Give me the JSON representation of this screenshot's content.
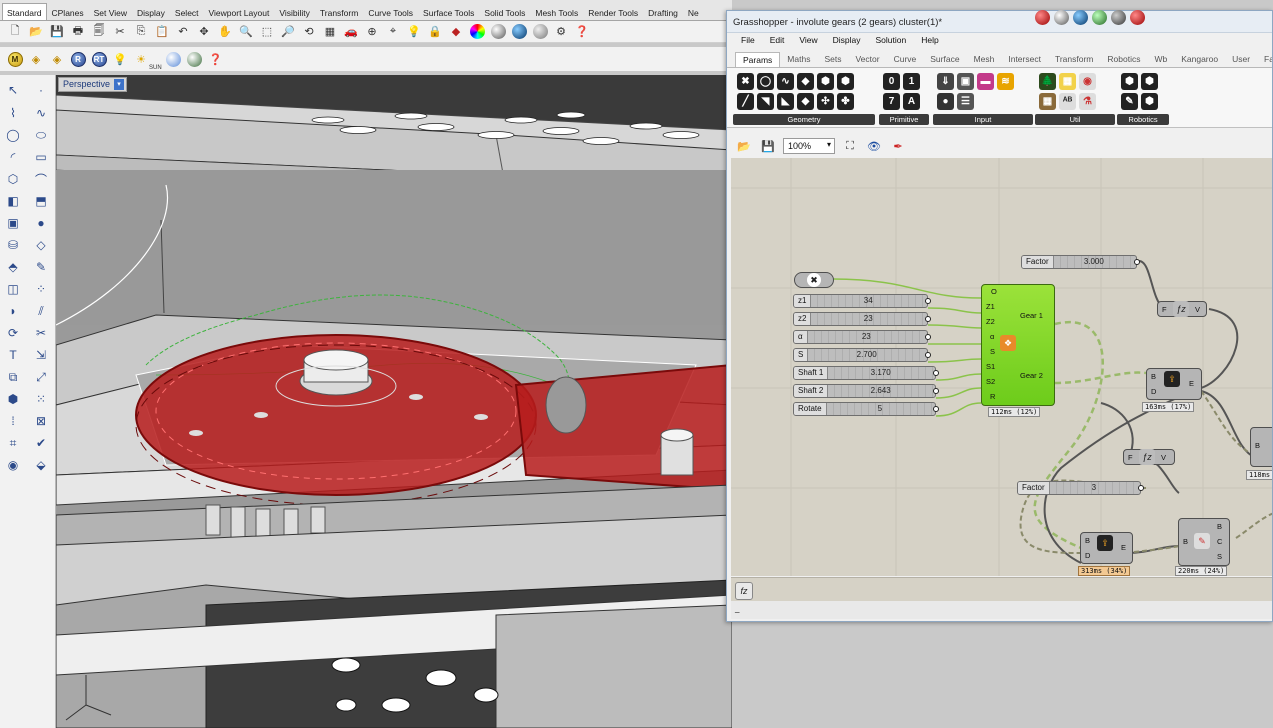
{
  "rhino": {
    "tabs": [
      "Standard",
      "CPlanes",
      "Set View",
      "Display",
      "Select",
      "Viewport Layout",
      "Visibility",
      "Transform",
      "Curve Tools",
      "Surface Tools",
      "Solid Tools",
      "Mesh Tools",
      "Render Tools",
      "Drafting",
      "Ne"
    ],
    "active_tab": "Standard",
    "toolbar2": {
      "sun_label": "SUN",
      "rt_label": "RT",
      "r_label": "R",
      "m_label": "M"
    },
    "viewport_label": "Perspective"
  },
  "grasshopper": {
    "title": "Grasshopper - involute gears (2 gears) cluster(1)*",
    "menu": [
      "File",
      "Edit",
      "View",
      "Display",
      "Solution",
      "Help"
    ],
    "ribbon_tabs": [
      "Params",
      "Maths",
      "Sets",
      "Vector",
      "Curve",
      "Surface",
      "Mesh",
      "Intersect",
      "Transform",
      "Robotics",
      "Wb",
      "Kangaroo",
      "User",
      "FabTools"
    ],
    "active_ribbon_tab": "Params",
    "ribbon_groups": [
      "Geometry",
      "Primitive",
      "Input",
      "Util",
      "Robotics"
    ],
    "zoom": "100%",
    "sliders": [
      {
        "name": "Factor",
        "value": "3.000"
      },
      {
        "name": "z1",
        "value": "34"
      },
      {
        "name": "z2",
        "value": "23"
      },
      {
        "name": "α",
        "value": "23"
      },
      {
        "name": "S",
        "value": "2.700"
      },
      {
        "name": "Shaft 1",
        "value": "3.170"
      },
      {
        "name": "Shaft 2",
        "value": "2.643"
      },
      {
        "name": "Rotate",
        "value": "5"
      },
      {
        "name": "Factor",
        "value": "3"
      }
    ],
    "cluster": {
      "inputs": [
        "O",
        "Z1",
        "Z2",
        "α",
        "S",
        "S1",
        "S2",
        "R"
      ],
      "outputs": [
        "Gear 1",
        "Gear 2"
      ],
      "timing": "112ms (12%)"
    },
    "fz1": {
      "in": "F",
      "out": "V"
    },
    "fz2": {
      "in": "F",
      "out": "V"
    },
    "comp_bde1": {
      "inputs": [
        "B",
        "D"
      ],
      "output": "E",
      "timing": "163ms (17%)"
    },
    "comp_bde2": {
      "inputs": [
        "B",
        "D"
      ],
      "output": "E",
      "timing": "313ms (34%)"
    },
    "comp_bcs": {
      "input": "B",
      "outputs": [
        "B",
        "C",
        "S"
      ],
      "timing": "220ms (24%)"
    },
    "comp_partial": {
      "input": "B",
      "timing": "118ms"
    },
    "status_icon": "fz",
    "status_text": "_"
  }
}
